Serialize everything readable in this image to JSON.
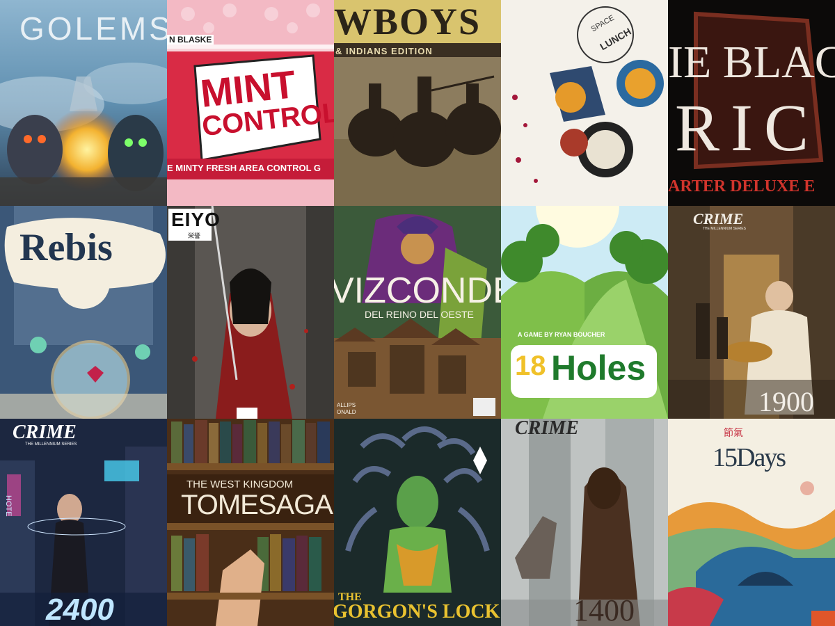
{
  "tiles": [
    {
      "title": "GOLEMS"
    },
    {
      "top": "N BLASKE",
      "title1": "MINT",
      "title2": "CONTROL",
      "subtitle": "E MINTY FRESH AREA CONTROL G"
    },
    {
      "title": "WBOYS",
      "subtitle": "& INDIANS EDITION"
    },
    {
      "title1": "SPACE",
      "title2": "LUNCH"
    },
    {
      "title1": "IE BLAC",
      "title2": "RIC",
      "subtitle": "ARTER DELUXE E"
    },
    {
      "title": "Rebis"
    },
    {
      "title": "EIYO",
      "kanji": "栄誉"
    },
    {
      "title": "VIZCONDES",
      "subtitle": "DEL REINO DEL OESTE",
      "credit1": "ALLIPS",
      "credit2": "ONALD"
    },
    {
      "byline": "A GAME BY RYAN BOUCHER",
      "num": "18",
      "title": "Holes"
    },
    {
      "title": "CRIME",
      "series": "THE MILLENNIUM SERIES",
      "year": "1900"
    },
    {
      "title": "CRIME",
      "series": "THE MILLENNIUM SERIES",
      "year": "2400",
      "sign": "HOTE"
    },
    {
      "top": "THE WEST KINGDOM",
      "title": "TOMESAGA"
    },
    {
      "title1": "THE",
      "title2": "GORGON'S LOCK"
    },
    {
      "title": "CRIME",
      "year": "1400"
    },
    {
      "kanji": "節氣",
      "title": "15Days"
    }
  ]
}
